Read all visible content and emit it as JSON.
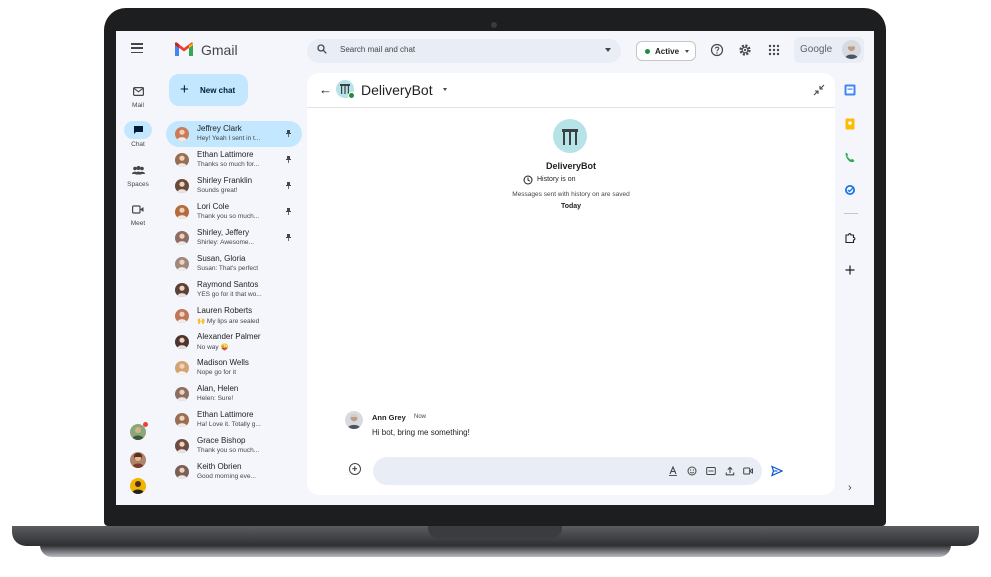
{
  "app": {
    "name": "Gmail"
  },
  "search": {
    "placeholder": "Search mail and chat"
  },
  "status": {
    "label": "Active",
    "color": "#1e8e3e"
  },
  "brand": {
    "google_word": "Google"
  },
  "rail": {
    "items": [
      {
        "label": "Mail",
        "icon": "mail-icon"
      },
      {
        "label": "Chat",
        "icon": "chat-icon"
      },
      {
        "label": "Spaces",
        "icon": "spaces-icon"
      },
      {
        "label": "Meet",
        "icon": "meet-icon"
      }
    ]
  },
  "new_chat": {
    "label": "New chat"
  },
  "chats": [
    {
      "name": "Jeffrey Clark",
      "preview": "Hey! Yeah I sent in t...",
      "pinned": true,
      "selected": true,
      "color": "#c97b5a"
    },
    {
      "name": "Ethan Lattimore",
      "preview": "Thanks so much for...",
      "pinned": true,
      "color": "#9a6e52"
    },
    {
      "name": "Shirley Franklin",
      "preview": "Sounds great!",
      "pinned": true,
      "color": "#6a4a3a"
    },
    {
      "name": "Lori Cole",
      "preview": "Thank you so much...",
      "pinned": true,
      "color": "#b56b3d"
    },
    {
      "name": "Shirley, Jeffery",
      "preview": "Shirley: Awesome...",
      "pinned": true,
      "color": "#8d6e63"
    },
    {
      "name": "Susan, Gloria",
      "preview": "Susan: That's perfect",
      "color": "#a1887f"
    },
    {
      "name": "Raymond Santos",
      "preview": "YES go for it that wo...",
      "color": "#5d4037"
    },
    {
      "name": "Lauren Roberts",
      "preview": "🙌 My lips are sealed",
      "color": "#c0765a"
    },
    {
      "name": "Alexander Palmer",
      "preview": "No way 😜",
      "color": "#4e342e"
    },
    {
      "name": "Madison Wells",
      "preview": "Nope go for it",
      "color": "#d4a373"
    },
    {
      "name": "Alan, Helen",
      "preview": "Helen: Sure!",
      "color": "#8d6e63"
    },
    {
      "name": "Ethan Lattimore",
      "preview": "Ha! Love it. Totally g...",
      "color": "#9a6e52"
    },
    {
      "name": "Grace Bishop",
      "preview": "Thank you so much...",
      "color": "#6d4c41"
    },
    {
      "name": "Keith Obrien",
      "preview": "Good morning eve...",
      "color": "#7b5e57"
    }
  ],
  "conversation": {
    "title": "DeliveryBot",
    "bot_name": "DeliveryBot",
    "history_status": "History is on",
    "history_note": "Messages sent with history on are saved",
    "day_label": "Today",
    "message": {
      "sender": "Ann Grey",
      "time": "Now",
      "text": "Hi bot, bring me something!"
    }
  },
  "colors": {
    "accent": "#c2e7ff",
    "bot_avatar": "#b6e3e7",
    "compose_bg": "#e9eef6",
    "send": "#0b57d0"
  }
}
